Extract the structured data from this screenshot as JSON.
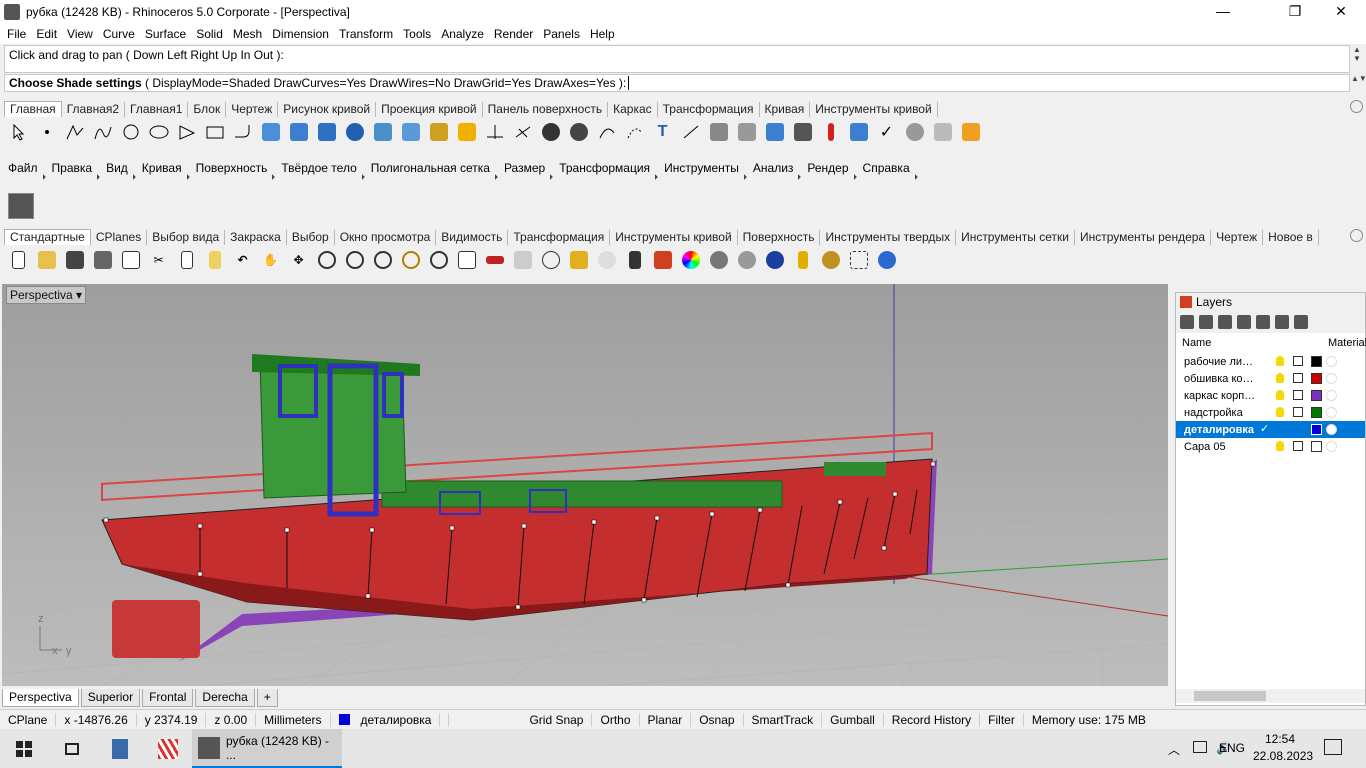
{
  "window": {
    "title": "рубка (12428 KB) - Rhinoceros  5.0 Corporate - [Perspectiva]",
    "minimize": "—",
    "maximize": "❐",
    "close": "✕"
  },
  "menu": [
    "File",
    "Edit",
    "View",
    "Curve",
    "Surface",
    "Solid",
    "Mesh",
    "Dimension",
    "Transform",
    "Tools",
    "Analyze",
    "Render",
    "Panels",
    "Help"
  ],
  "command": {
    "history": "Click and drag to pan ( Down  Left  Right  Up  In  Out ):",
    "prompt_bold": "Choose Shade settings",
    "prompt_rest": " ( DisplayMode=Shaded  DrawCurves=Yes  DrawWires=No  DrawGrid=Yes  DrawAxes=Yes ):"
  },
  "toolbar_tabs_1": [
    "Главная",
    "Главная2",
    "Главная1",
    "Блок",
    "Чертеж",
    "Рисунок кривой",
    "Проекция кривой",
    "Панель поверхность",
    "Каркас",
    "Трансформация",
    "Кривая",
    "Инструменты кривой"
  ],
  "ru_tools": [
    "Файл",
    "Правка",
    "Вид",
    "Кривая",
    "Поверхность",
    "Твёрдое тело",
    "Полигональная сетка",
    "Размер",
    "Трансформация",
    "Инструменты",
    "Анализ",
    "Рендер",
    "Справка"
  ],
  "toolbar_tabs_2": [
    "Стандартные",
    "CPlanes",
    "Выбор вида",
    "Закраска",
    "Выбор",
    "Окно просмотра",
    "Видимость",
    "Трансформация",
    "Инструменты кривой",
    "Поверхность",
    "Инструменты твердых",
    "Инструменты сетки",
    "Инструменты рендера",
    "Чертеж",
    "Новое в"
  ],
  "viewport": {
    "title": "Perspectiva",
    "axis_z": "z",
    "axis_x": "x",
    "axis_y": "y"
  },
  "viewport_tabs": [
    "Perspectiva",
    "Superior",
    "Frontal",
    "Derecha",
    "+"
  ],
  "layers": {
    "panel_title": "Layers",
    "col_name": "Name",
    "col_material": "Material",
    "rows": [
      {
        "name": "рабочие линии",
        "color": "#000000",
        "current": false
      },
      {
        "name": "обшивка корпуса",
        "color": "#cc0000",
        "current": false
      },
      {
        "name": "каркас корпуса",
        "color": "#7b2fbe",
        "current": false
      },
      {
        "name": "надстройка",
        "color": "#007a00",
        "current": false
      },
      {
        "name": "деталировка",
        "color": "#0000dd",
        "current": true
      },
      {
        "name": "Capa 05",
        "color": "#ffffff",
        "current": false
      }
    ],
    "check": "✓"
  },
  "status": {
    "cplane": "CPlane",
    "x": "x -14876.26",
    "y": "y 2374.19",
    "z": "z 0.00",
    "units": "Millimeters",
    "layer": "деталировка",
    "layer_color": "#0000dd",
    "grid_snap": "Grid Snap",
    "ortho": "Ortho",
    "planar": "Planar",
    "osnap": "Osnap",
    "smarttrack": "SmartTrack",
    "gumball": "Gumball",
    "record_history": "Record History",
    "filter": "Filter",
    "memory": "Memory use: 175 MB"
  },
  "taskbar": {
    "app_label": "рубка (12428 KB) - ...",
    "lang": "ENG",
    "time": "12:54",
    "date": "22.08.2023"
  }
}
